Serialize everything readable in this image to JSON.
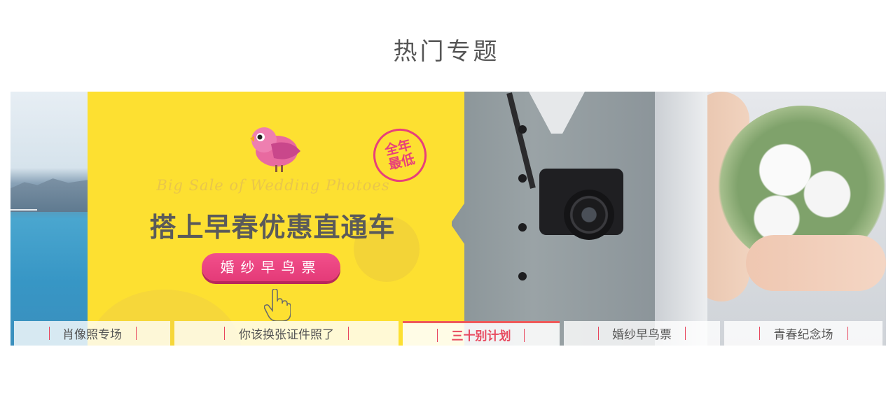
{
  "section": {
    "title": "热门专题"
  },
  "banner": {
    "stamp_line1": "全年",
    "stamp_line2": "最低",
    "script_text": "Big Sale of Wedding Photoes",
    "headline": "搭上早春优惠直通车",
    "cta_label": "婚纱早鸟票",
    "accent_color": "#fde031",
    "cta_color": "#e8407a"
  },
  "tabs": [
    {
      "label": "肖像照专场",
      "active": false
    },
    {
      "label": "你该换张证件照了",
      "active": false
    },
    {
      "label": "三十别计划",
      "active": true
    },
    {
      "label": "婚纱早鸟票",
      "active": false
    },
    {
      "label": "青春纪念场",
      "active": false
    }
  ],
  "colors": {
    "active_tab": "#e84a5f",
    "divider": "#e8455c",
    "title": "#555555"
  }
}
